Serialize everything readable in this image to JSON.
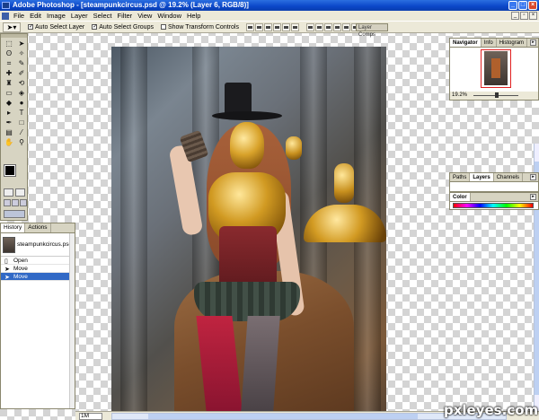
{
  "window": {
    "title": "Adobe Photoshop - [steampunkcircus.psd @ 19.2% (Layer 6, RGB/8)]"
  },
  "menu": [
    "File",
    "Edit",
    "Image",
    "Layer",
    "Select",
    "Filter",
    "View",
    "Window",
    "Help"
  ],
  "options": {
    "auto_select_layer": "Auto Select Layer",
    "auto_select_groups": "Auto Select Groups",
    "show_transform_controls": "Show Transform Controls",
    "layer_comps": "Layer Comps"
  },
  "history": {
    "tabs": [
      "History",
      "Actions"
    ],
    "snapshot": "steampunkcircus.psd",
    "items": [
      {
        "label": "Open",
        "selected": false
      },
      {
        "label": "Move",
        "selected": false
      },
      {
        "label": "Move",
        "selected": true
      }
    ]
  },
  "navigator": {
    "tabs": [
      "Navigator",
      "Info",
      "Histogram"
    ],
    "zoom": "19.2%"
  },
  "layers_panel": {
    "tabs": [
      "Paths",
      "Layers",
      "Channels"
    ]
  },
  "color_panel": {
    "tabs": [
      "Color"
    ]
  },
  "status": {
    "zoom": "1M"
  },
  "watermark": "pxleyes.com"
}
